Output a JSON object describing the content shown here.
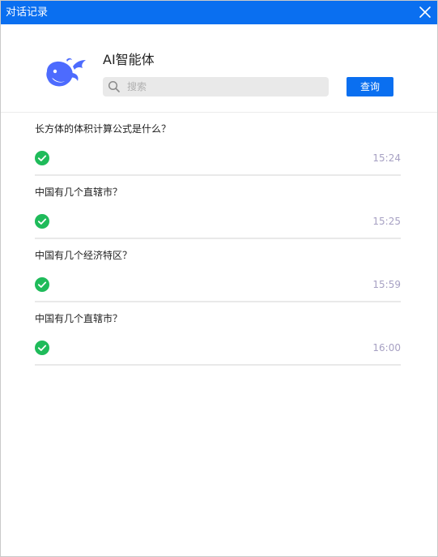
{
  "window": {
    "title": "对话记录",
    "title_bar_color": "#0a6ff0"
  },
  "agent": {
    "name": "AI智能体",
    "logo_icon": "whale-logo-icon",
    "logo_color": "#4d6bfe"
  },
  "search": {
    "placeholder": "搜索",
    "value": "",
    "button_label": "查询"
  },
  "records": [
    {
      "question": "长方体的体积计算公式是什么？",
      "time": "15:24",
      "status": "completed"
    },
    {
      "question": "中国有几个直辖市？",
      "time": "15:25",
      "status": "completed"
    },
    {
      "question": "中国有几个经济特区？",
      "time": "15:59",
      "status": "completed"
    },
    {
      "question": "中国有几个直辖市？",
      "time": "16:00",
      "status": "completed"
    }
  ],
  "colors": {
    "accent": "#0a6ff0",
    "success": "#1fbb5a",
    "time_text": "#a7a1c3"
  }
}
